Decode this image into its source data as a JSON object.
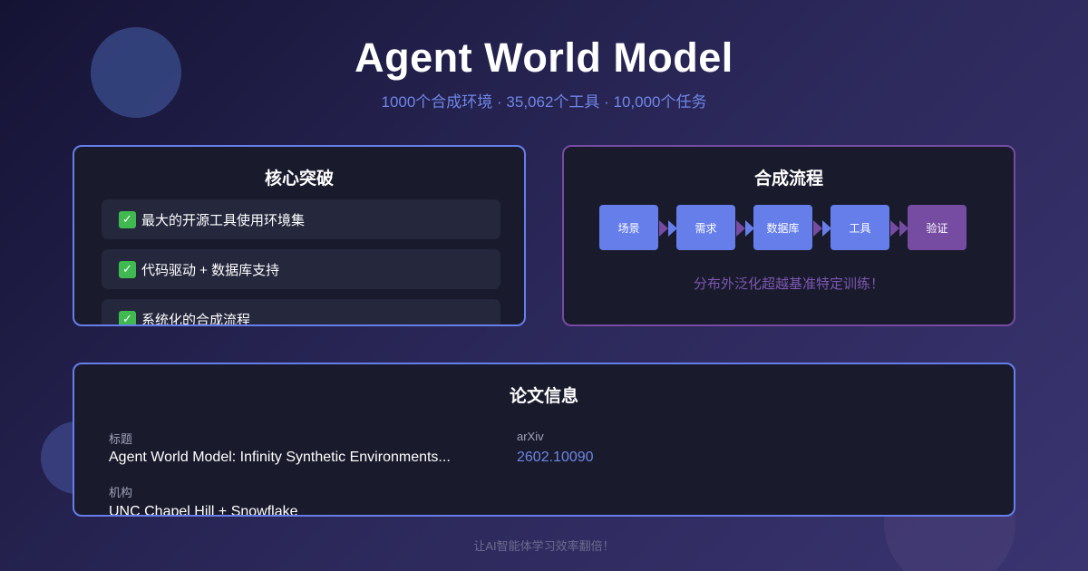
{
  "header": {
    "title": "Agent World Model",
    "subtitle": "1000个合成环境 · 35,062个工具 · 10,000个任务"
  },
  "breakthroughs": {
    "title": "核心突破",
    "items": [
      {
        "icon": "checkmark-icon",
        "label": "最大的开源工具使用环境集"
      },
      {
        "icon": "checkmark-icon",
        "label": "代码驱动 + 数据库支持"
      },
      {
        "icon": "checkmark-icon",
        "label": "系统化的合成流程"
      }
    ]
  },
  "pipeline": {
    "title": "合成流程",
    "steps": [
      "场景",
      "需求",
      "数据库",
      "工具",
      "验证"
    ],
    "note": "分布外泛化超越基准特定训练！"
  },
  "paper": {
    "title": "论文信息",
    "title_label": "标题",
    "title_value": "Agent World Model: Infinity Synthetic Environments...",
    "arxiv_label": "arXiv",
    "arxiv_value": "2602.10090",
    "org_label": "机构",
    "org_value": "UNC Chapel Hill + Snowflake"
  },
  "footer": "让AI智能体学习效率翻倍！",
  "colors": {
    "accent_blue": "#667eea",
    "accent_purple": "#764ba2",
    "check_green": "#3fb950"
  }
}
